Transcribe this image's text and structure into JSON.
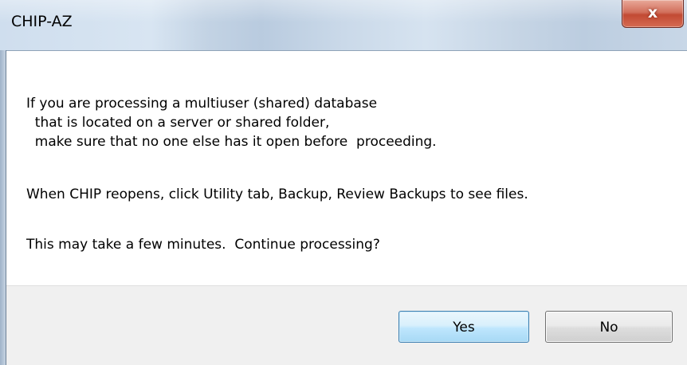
{
  "window": {
    "title": "CHIP-AZ",
    "close_symbol": "x"
  },
  "message": {
    "line1": "If you are processing a multiuser (shared) database",
    "line2": "  that is located on a server or shared folder,",
    "line3": "  make sure that no one else has it open before  proceeding.",
    "line4": "When CHIP reopens, click Utility tab, Backup, Review Backups to see files.",
    "line5": "This may take a few minutes.  Continue processing?"
  },
  "buttons": {
    "yes_label": "Yes",
    "no_label": "No"
  },
  "colors": {
    "close_button": "#c24a33",
    "default_button_border": "#3c7fb1",
    "footer_background": "#f0f0f0"
  }
}
